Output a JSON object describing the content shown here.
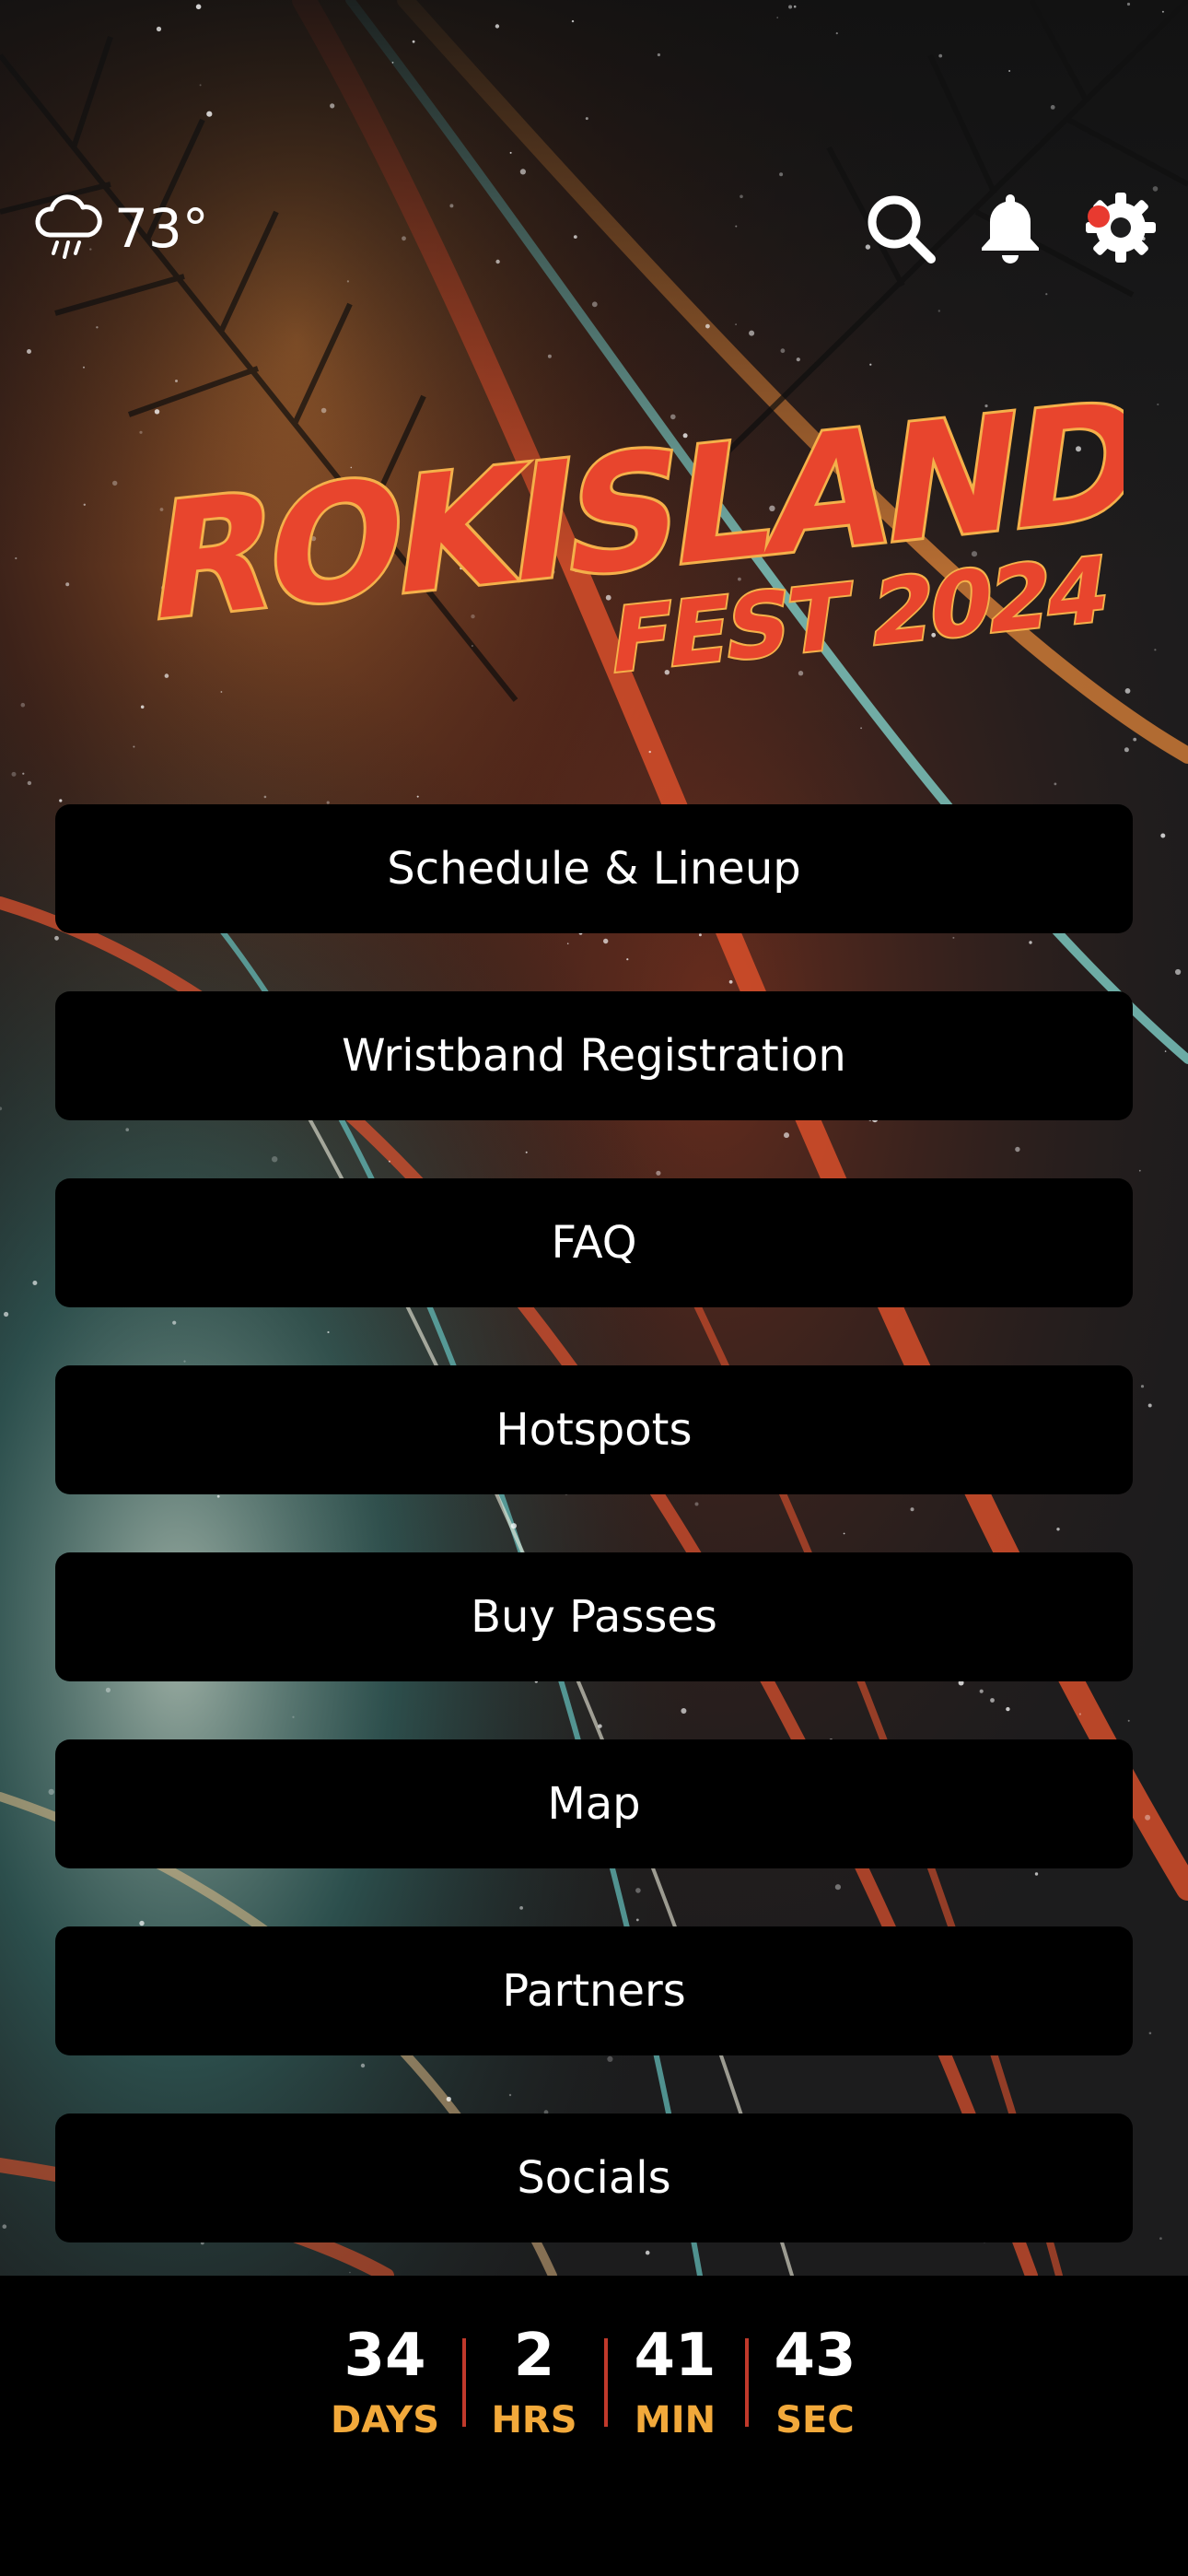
{
  "weather": {
    "temperature": "73°",
    "icon": "rain-cloud-icon"
  },
  "header": {
    "icons": [
      "search-icon",
      "bell-icon",
      "gear-icon"
    ],
    "settings_badge_color": "#e83a30"
  },
  "logo": {
    "line1": "ROKISLAND",
    "line2": "FEST 2024",
    "color": "#e8452d",
    "edge_color": "#f4b04a"
  },
  "menu": {
    "items": [
      {
        "label": "Schedule & Lineup"
      },
      {
        "label": "Wristband Registration"
      },
      {
        "label": "FAQ"
      },
      {
        "label": "Hotspots"
      },
      {
        "label": "Buy Passes"
      },
      {
        "label": "Map"
      },
      {
        "label": "Partners"
      },
      {
        "label": "Socials"
      }
    ]
  },
  "countdown": {
    "units": [
      {
        "value": "34",
        "label": "DAYS"
      },
      {
        "value": "2",
        "label": "HRS"
      },
      {
        "value": "41",
        "label": "MIN"
      },
      {
        "value": "43",
        "label": "SEC"
      }
    ],
    "label_color": "#f2a93b",
    "divider_color": "#c0392b"
  }
}
